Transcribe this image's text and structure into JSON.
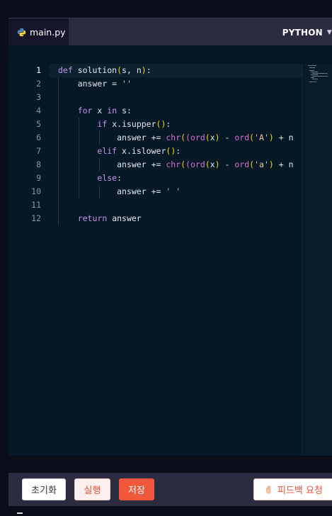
{
  "tab": {
    "filename": "main.py",
    "icon": "python-icon"
  },
  "language": {
    "label": "PYTHON"
  },
  "editor": {
    "line_numbers": [
      "1",
      "2",
      "3",
      "4",
      "5",
      "6",
      "7",
      "8",
      "9",
      "10",
      "11",
      "12"
    ],
    "active_line": 1,
    "lines": [
      "def solution(s, n):",
      "    answer = ''",
      "",
      "    for x in s:",
      "        if x.isupper():",
      "            answer += chr((ord(x) - ord('A') + n",
      "        elif x.islower():",
      "            answer += chr((ord(x) - ord('a') + n",
      "        else:",
      "            answer += ' '",
      "",
      "    return answer"
    ]
  },
  "footer": {
    "reset_label": "초기화",
    "run_label": "실행",
    "save_label": "저장",
    "feedback_label": "피드백 요청",
    "feedback_icon": "hand-icon"
  },
  "colors": {
    "accent": "#f0573b",
    "editor_bg": "#051826",
    "tabbar_bg": "#2a2b40"
  }
}
